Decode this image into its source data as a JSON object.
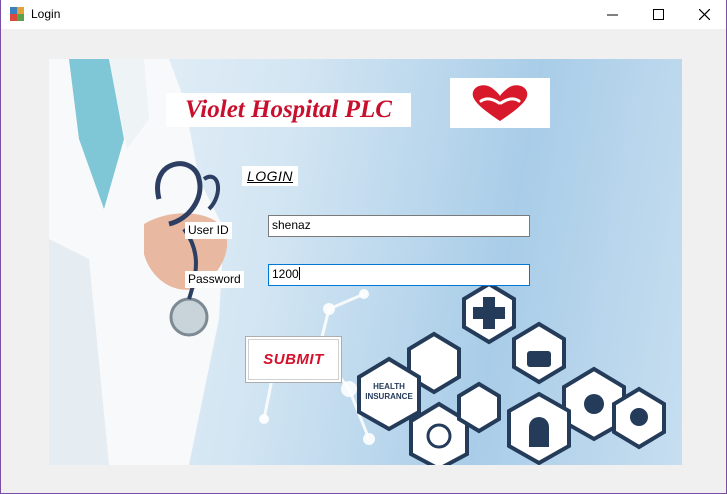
{
  "window": {
    "title": "Login",
    "border_color": "#7a4ea3"
  },
  "brand": {
    "name": "Violet Hospital PLC",
    "color": "#c8102e"
  },
  "form": {
    "heading": "LOGIN",
    "user_label": "User ID",
    "user_value": "shenaz",
    "password_label": "Password",
    "password_value": "1200",
    "submit_label": "SUBMIT"
  },
  "background": {
    "health_insurance_text": "HEALTH INSURANCE"
  },
  "icons": {
    "app": "app-window-icon",
    "minimize": "minimize-icon",
    "maximize": "maximize-icon",
    "close": "close-icon",
    "logo": "heart-hands-logo-icon"
  }
}
